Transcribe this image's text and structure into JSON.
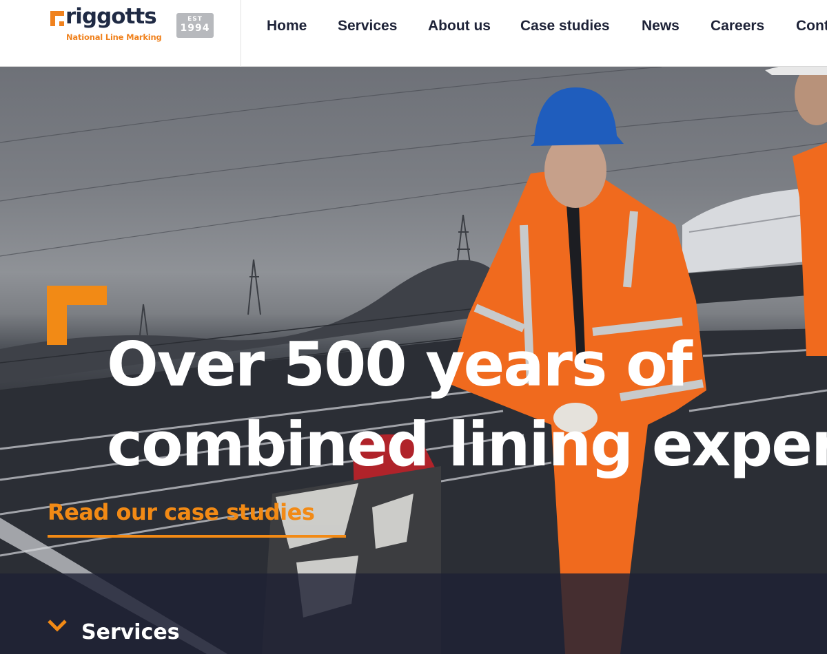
{
  "brand": {
    "name": "riggotts",
    "tagline": "National Line Marking",
    "est_label": "EST",
    "est_year": "1994",
    "accent_color": "#f0821e",
    "navy_color": "#1f2a44"
  },
  "nav": {
    "items": [
      {
        "label": "Home"
      },
      {
        "label": "Services"
      },
      {
        "label": "About us"
      },
      {
        "label": "Case studies"
      },
      {
        "label": "News"
      },
      {
        "label": "Careers"
      },
      {
        "label": "Cont"
      }
    ]
  },
  "hero": {
    "headline_line1": "Over 500 years of",
    "headline_line2": "combined lining exper",
    "cta_label": "Read our case studies",
    "services_label": "Services",
    "services_icon": "chevron-down-icon"
  }
}
